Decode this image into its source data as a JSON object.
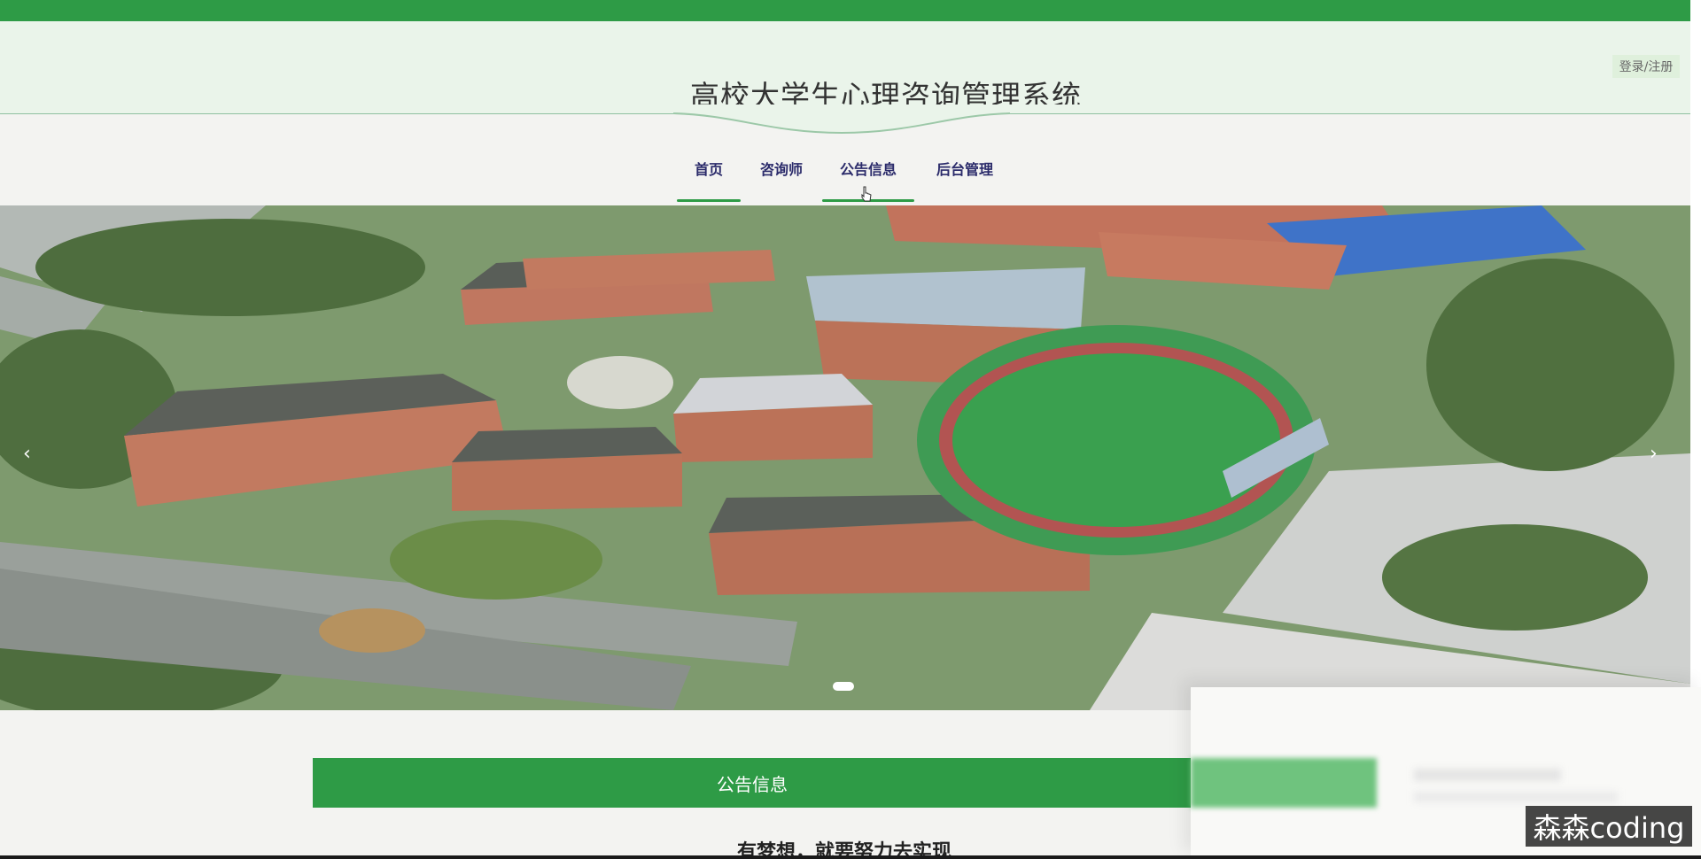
{
  "header": {
    "site_title": "高校大学生心理咨询管理系统",
    "login_label": "登录/注册"
  },
  "nav": {
    "items": [
      {
        "label": "首页"
      },
      {
        "label": "咨询师"
      },
      {
        "label": "公告信息"
      },
      {
        "label": "后台管理"
      }
    ]
  },
  "carousel": {
    "prev_icon": "chevron-left-icon",
    "next_icon": "chevron-right-icon",
    "prev_glyph": "‹",
    "next_glyph": "›",
    "active_slide": 1
  },
  "announcements": {
    "section_title": "公告信息",
    "motto": "有梦想，就要努力去实现"
  },
  "watermark": "森森coding",
  "colors": {
    "brand_green": "#2e9b46",
    "header_bg": "#eaf4ea",
    "nav_text": "#2a2a6a"
  }
}
